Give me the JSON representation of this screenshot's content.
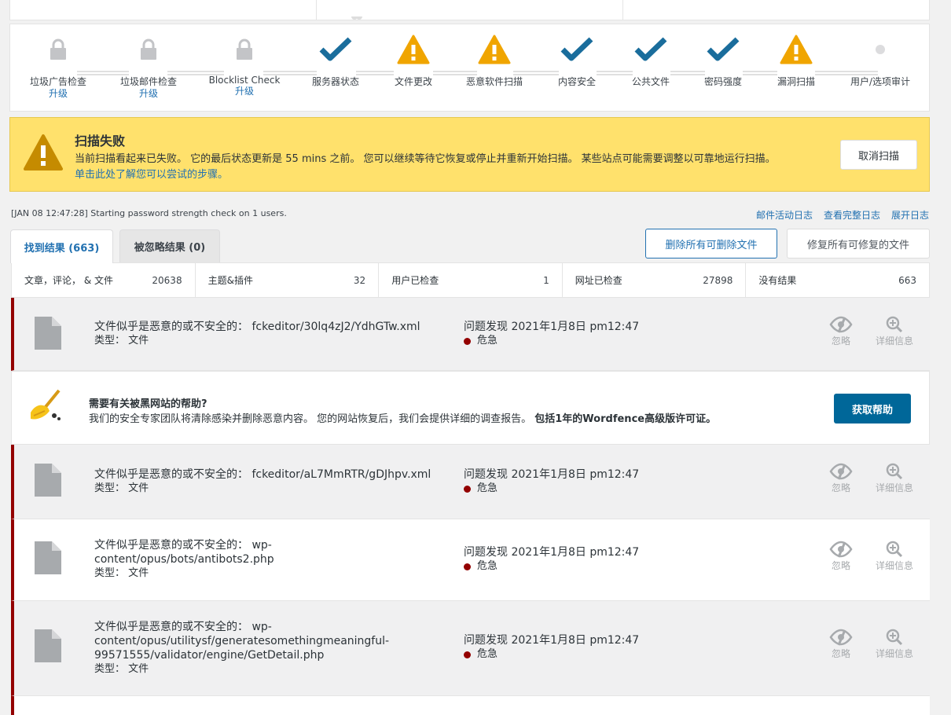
{
  "steps": [
    {
      "label": "垃圾广告检查",
      "sub": "升级",
      "icon": "lock-icon"
    },
    {
      "label": "垃圾邮件检查",
      "sub": "升级",
      "icon": "lock-icon"
    },
    {
      "label": "Blocklist Check",
      "sub": "升级",
      "icon": "lock-icon"
    },
    {
      "label": "服务器状态",
      "sub": "",
      "icon": "check-icon"
    },
    {
      "label": "文件更改",
      "sub": "",
      "icon": "warning-icon"
    },
    {
      "label": "恶意软件扫描",
      "sub": "",
      "icon": "warning-icon"
    },
    {
      "label": "内容安全",
      "sub": "",
      "icon": "check-icon"
    },
    {
      "label": "公共文件",
      "sub": "",
      "icon": "check-icon"
    },
    {
      "label": "密码强度",
      "sub": "",
      "icon": "check-icon"
    },
    {
      "label": "漏洞扫描",
      "sub": "",
      "icon": "warning-icon"
    },
    {
      "label": "用户/选项审计",
      "sub": "",
      "icon": "pending-dot-icon"
    }
  ],
  "alert": {
    "title": "扫描失败",
    "body": "当前扫描看起来已失败。 它的最后状态更新是 55 mins 之前。 您可以继续等待它恢复或停止并重新开始扫描。 某些站点可能需要调整以可靠地运行扫描。",
    "link": "单击此处了解您可以尝试的步骤。",
    "cancel_label": "取消扫描",
    "color": "#ffe16c"
  },
  "log": {
    "line": "[JAN 08 12:47:28] Starting password strength check on 1 users.",
    "links": [
      "邮件活动日志",
      "查看完整日志",
      "展开日志"
    ]
  },
  "tabs": {
    "found": "找到结果 (663)",
    "ignored": "被忽略结果 (0)"
  },
  "actions": {
    "delete_all": "删除所有可删除文件",
    "repair_all": "修复所有可修复的文件"
  },
  "stats": [
    {
      "label": "文章，评论， & 文件",
      "value": "20638"
    },
    {
      "label": "主题&插件",
      "value": "32"
    },
    {
      "label": "用户已检查",
      "value": "1"
    },
    {
      "label": "网址已检查",
      "value": "27898"
    },
    {
      "label": "没有结果",
      "value": "663"
    }
  ],
  "issues": [
    {
      "lines": [
        "文件似乎是恶意的或不安全的：  fckeditor/30lq4zJ2/YdhGTw.xml"
      ],
      "type": "类型：  文件",
      "found": "问题发现 2021年1月8日 pm12:47",
      "severity": "危急",
      "ignore": "忽略",
      "details": "详细信息"
    },
    {
      "lines": [
        "文件似乎是恶意的或不安全的：  fckeditor/aL7MmRTR/gDJhpv.xml"
      ],
      "type": "类型：  文件",
      "found": "问题发现 2021年1月8日 pm12:47",
      "severity": "危急",
      "ignore": "忽略",
      "details": "详细信息"
    },
    {
      "lines": [
        "文件似乎是恶意的或不安全的：  wp-",
        "content/opus/bots/antibots2.php"
      ],
      "type": "类型：  文件",
      "found": "问题发现 2021年1月8日 pm12:47",
      "severity": "危急",
      "ignore": "忽略",
      "details": "详细信息"
    },
    {
      "lines": [
        "文件似乎是恶意的或不安全的：  wp-",
        "content/opus/utilitysf/generatesomethingmeaningful-",
        "99571555/validator/engine/GetDetail.php"
      ],
      "type": "类型：  文件",
      "found": "问题发现 2021年1月8日 pm12:47",
      "severity": "危急",
      "ignore": "忽略",
      "details": "详细信息"
    }
  ],
  "help": {
    "title": "需要有关被黑网站的帮助?",
    "body": "我们的安全专家团队将清除感染并删除恶意内容。 您的网站恢复后，我们会提供详细的调查报告。 ",
    "bold": "包括1年的Wordfence高级版许可证。",
    "button": "获取帮助"
  },
  "colors": {
    "accent": "#2271b1",
    "check": "#1a6d9c",
    "warning": "#f0a500",
    "critical": "#930000",
    "lock": "#c3c4c7"
  }
}
